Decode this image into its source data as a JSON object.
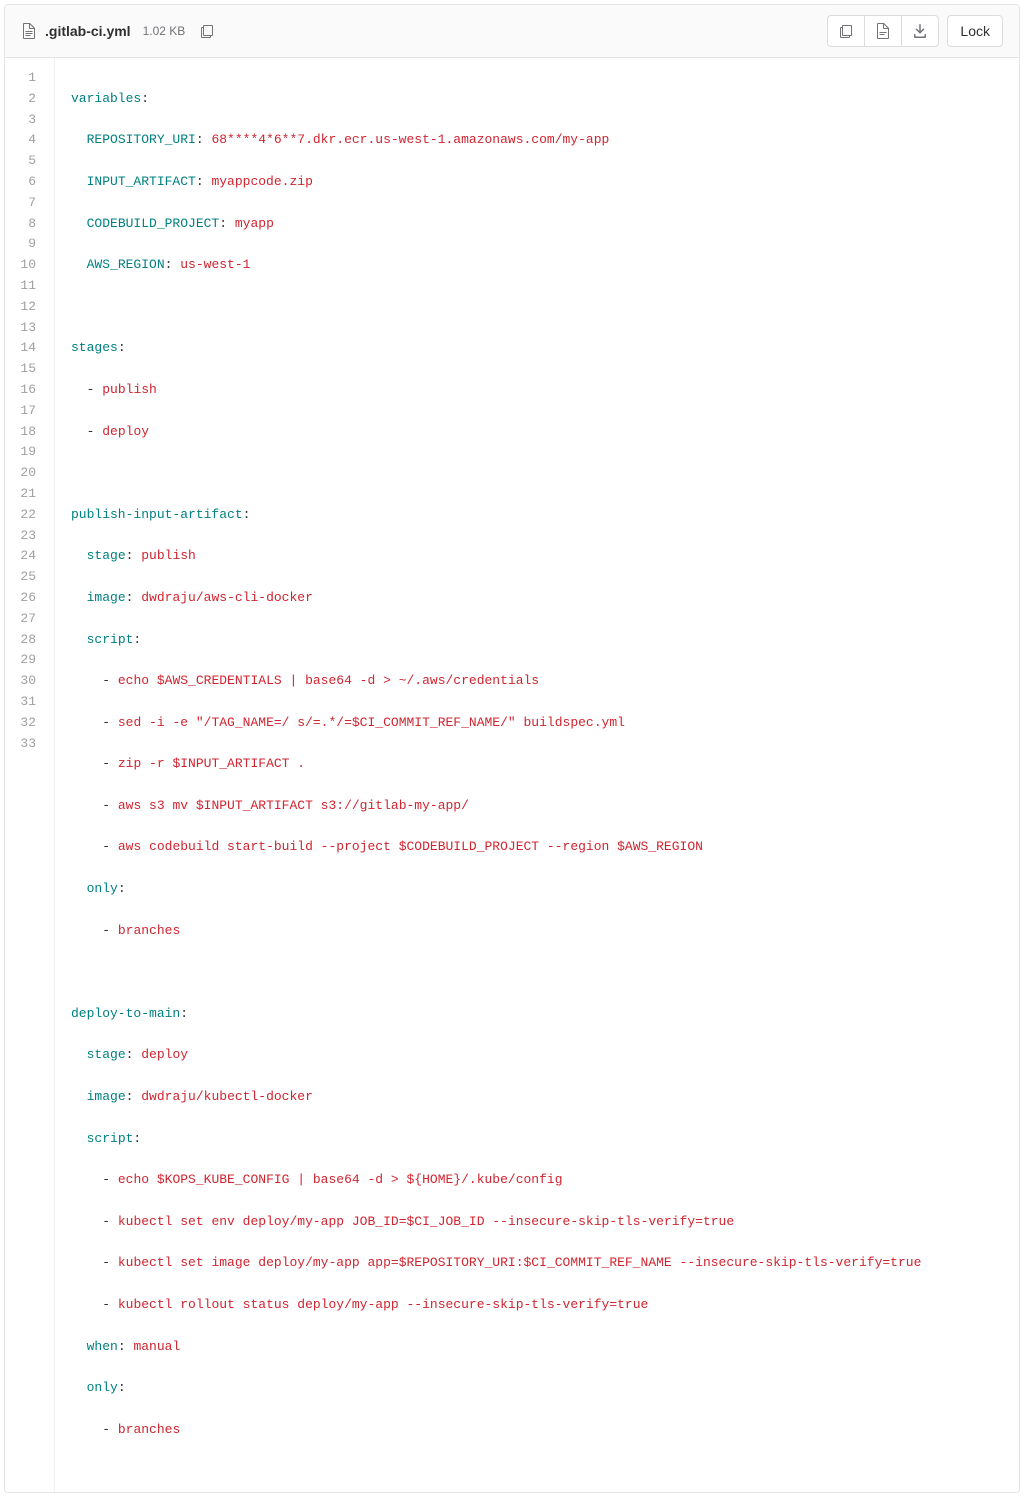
{
  "header": {
    "filename": ".gitlab-ci.yml",
    "filesize": "1.02 KB",
    "lock_label": "Lock"
  },
  "line_numbers": [
    "1",
    "2",
    "3",
    "4",
    "5",
    "6",
    "7",
    "8",
    "9",
    "10",
    "11",
    "12",
    "13",
    "14",
    "15",
    "16",
    "17",
    "18",
    "19",
    "20",
    "21",
    "22",
    "23",
    "24",
    "25",
    "26",
    "27",
    "28",
    "29",
    "30",
    "31",
    "32",
    "33"
  ],
  "code": {
    "l1_key": "variables",
    "l2_key": "REPOSITORY_URI",
    "l2_val": "68****4*6**7.dkr.ecr.us-west-1.amazonaws.com/my-app",
    "l3_key": "INPUT_ARTIFACT",
    "l3_val": "myappcode.zip",
    "l4_key": "CODEBUILD_PROJECT",
    "l4_val": "myapp",
    "l5_key": "AWS_REGION",
    "l5_val": "us-west-1",
    "l7_key": "stages",
    "l8_val": "publish",
    "l9_val": "deploy",
    "l11_key": "publish-input-artifact",
    "l12_key": "stage",
    "l12_val": "publish",
    "l13_key": "image",
    "l13_val": "dwdraju/aws-cli-docker",
    "l14_key": "script",
    "l15_val": "echo $AWS_CREDENTIALS | base64 -d > ~/.aws/credentials",
    "l16_val": "sed -i -e \"/TAG_NAME=/ s/=.*/=$CI_COMMIT_REF_NAME/\" buildspec.yml",
    "l17_val": "zip -r $INPUT_ARTIFACT .",
    "l18_val": "aws s3 mv $INPUT_ARTIFACT s3://gitlab-my-app/",
    "l19_val": "aws codebuild start-build --project $CODEBUILD_PROJECT --region $AWS_REGION",
    "l20_key": "only",
    "l21_val": "branches",
    "l23_key": "deploy-to-main",
    "l24_key": "stage",
    "l24_val": "deploy",
    "l25_key": "image",
    "l25_val": "dwdraju/kubectl-docker",
    "l26_key": "script",
    "l27_val": "echo $KOPS_KUBE_CONFIG | base64 -d > ${HOME}/.kube/config",
    "l28_val": "kubectl set env deploy/my-app JOB_ID=$CI_JOB_ID --insecure-skip-tls-verify=true",
    "l29_val": "kubectl set image deploy/my-app app=$REPOSITORY_URI:$CI_COMMIT_REF_NAME --insecure-skip-tls-verify=true",
    "l30_val": "kubectl rollout status deploy/my-app --insecure-skip-tls-verify=true",
    "l31_key": "when",
    "l31_val": "manual",
    "l32_key": "only",
    "l33_val": "branches"
  }
}
